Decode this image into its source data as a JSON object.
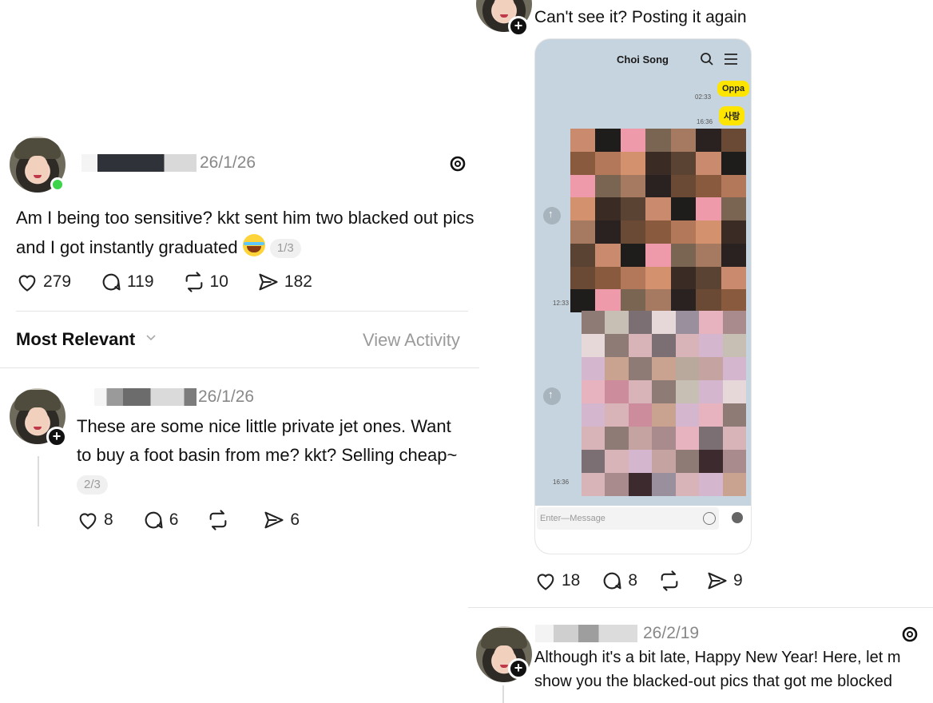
{
  "post_main": {
    "date": "26/1/26",
    "text": "Am I being too sensitive? kkt sent him two blacked out pics and I got instantly graduated",
    "pager": "1/3",
    "likes": "279",
    "replies": "119",
    "reposts": "10",
    "shares": "182"
  },
  "sort_bar": {
    "sort_label": "Most Relevant",
    "view_activity": "View Activity"
  },
  "reply_one": {
    "date": "26/1/26",
    "text": "These are some nice little private jet ones. Want to buy a foot basin from me? kkt? Selling cheap~",
    "pager": "2/3",
    "likes": "8",
    "replies": "6",
    "reposts": "",
    "shares": "6"
  },
  "reply_two": {
    "text": "Can't see it? Posting it again",
    "likes": "18",
    "replies": "8",
    "reposts": "",
    "shares": "9"
  },
  "chat_screenshot": {
    "contact": "Choi Song",
    "bubble_one": "Oppa",
    "bubble_one_time": "02:33",
    "bubble_two": "사랑",
    "bubble_two_time": "16:36",
    "time_left_one": "12:33",
    "time_left_two": "16:36",
    "input_placeholder": "Enter—Message"
  },
  "reply_three": {
    "date": "26/2/19",
    "text_line_one": "Although it's a bit late, Happy New Year! Here, let m",
    "text_line_two": "show you the blacked-out pics that got me blocked"
  },
  "colors": {
    "online": "#3dd44b",
    "chat_bubble": "#fee500",
    "muted_text": "#888888"
  },
  "icons": [
    "heart-icon",
    "comment-icon",
    "repost-icon",
    "share-icon",
    "threads-logo-icon",
    "search-icon",
    "menu-icon",
    "chevron-down-icon",
    "plus-icon"
  ]
}
